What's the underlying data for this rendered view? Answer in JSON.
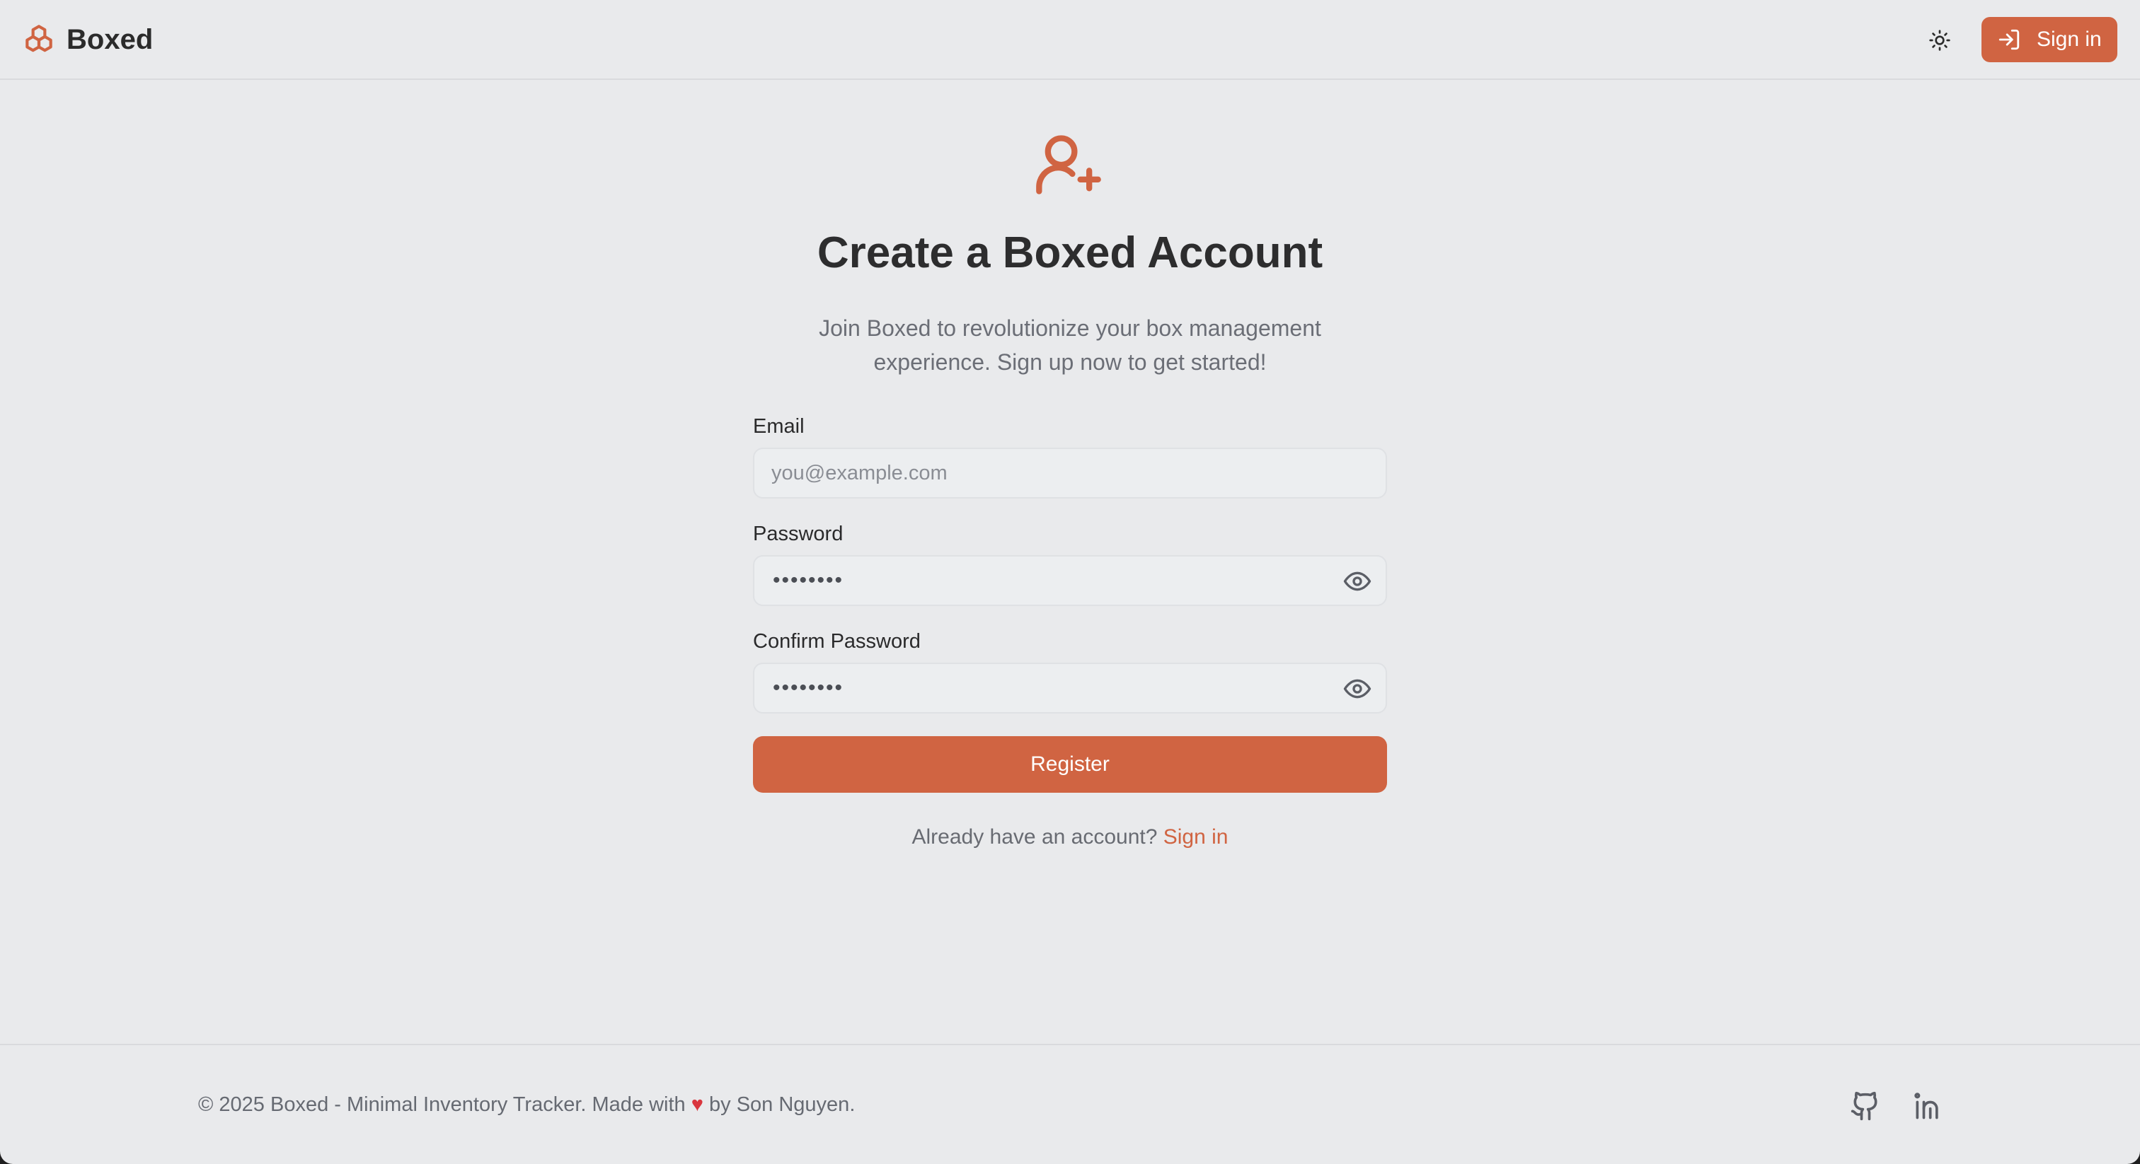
{
  "header": {
    "brand_name": "Boxed",
    "signin_label": "Sign in",
    "accent_color": "#d06442"
  },
  "main": {
    "title": "Create a Boxed Account",
    "subtitle": "Join Boxed to revolutionize your box management experience. Sign up now to get started!",
    "email": {
      "label": "Email",
      "placeholder": "you@example.com",
      "value": ""
    },
    "password": {
      "label": "Password",
      "masked_value": "••••••••"
    },
    "confirm_password": {
      "label": "Confirm Password",
      "masked_value": "••••••••"
    },
    "register_label": "Register",
    "already_text": "Already have an account?",
    "signin_link": "Sign in"
  },
  "footer": {
    "copyright_prefix": "© 2025 Boxed - Minimal Inventory Tracker. Made with",
    "heart": "♥",
    "copyright_suffix": "by Son Nguyen."
  },
  "icons": [
    "boxes-logo-icon",
    "sun-icon",
    "sign-in-arrow-icon",
    "user-plus-icon",
    "eye-icon",
    "github-icon",
    "linkedin-icon"
  ]
}
